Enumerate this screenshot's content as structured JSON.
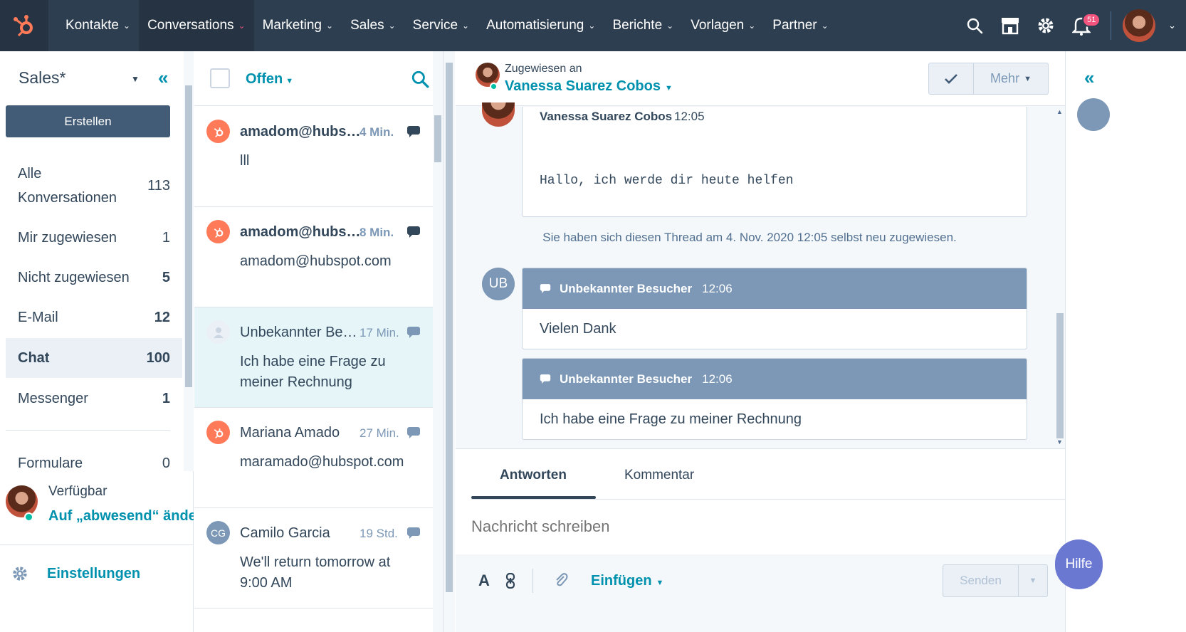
{
  "topnav": {
    "items": [
      {
        "label": "Kontakte"
      },
      {
        "label": "Conversations",
        "active": true
      },
      {
        "label": "Marketing"
      },
      {
        "label": "Sales"
      },
      {
        "label": "Service"
      },
      {
        "label": "Automatisierung"
      },
      {
        "label": "Berichte"
      },
      {
        "label": "Vorlagen"
      },
      {
        "label": "Partner"
      }
    ],
    "notifications_count": "51"
  },
  "sidebar": {
    "title": "Sales*",
    "create_label": "Erstellen",
    "items": [
      {
        "label": "Alle Konversationen",
        "count": "113"
      },
      {
        "label": "Mir zugewiesen",
        "count": "1"
      },
      {
        "label": "Nicht zugewiesen",
        "count": "5"
      },
      {
        "label": "E-Mail",
        "count": "12"
      },
      {
        "label": "Chat",
        "count": "100"
      },
      {
        "label": "Messenger",
        "count": "1"
      },
      {
        "label": "Formulare",
        "count": "0"
      }
    ],
    "status": "Verfügbar",
    "away_link": "Auf „abwesend“ ändern",
    "settings_label": "Einstellungen"
  },
  "convlist": {
    "filter_label": "Offen",
    "conversations": [
      {
        "name": "amadom@hubspot.com",
        "time": "4 Min.",
        "preview": "lll",
        "avatar": "hubspot"
      },
      {
        "name": "amadom@hubspot.com",
        "time": "8 Min.",
        "preview": "amadom@hubspot.com",
        "avatar": "hubspot"
      },
      {
        "name": "Unbekannter Besucher",
        "time": "17 Min.",
        "preview": "Ich habe eine Frage zu meiner Rechnung",
        "avatar": "unknown"
      },
      {
        "name": "Mariana Amado",
        "time": "27 Min.",
        "preview": "maramado@hubspot.com",
        "avatar": "hubspot"
      },
      {
        "name": "Camilo Garcia",
        "time": "19 Std.",
        "preview": "We'll return tomorrow at 9:00 AM",
        "avatar": "CG",
        "initials": "CG"
      }
    ]
  },
  "thread": {
    "assigned_label": "Zugewiesen an",
    "assignee": "Vanessa Suarez Cobos",
    "more_label": "Mehr",
    "agent_message": {
      "name": "Vanessa Suarez Cobos",
      "time": "12:05",
      "text": "Hallo, ich werde dir heute helfen"
    },
    "system_note": "Sie haben sich diesen Thread am 4. Nov. 2020 12:05 selbst neu zugewiesen.",
    "visitor_initials": "UB",
    "visitor_messages": [
      {
        "name": "Unbekannter Besucher",
        "time": "12:06",
        "text": "Vielen Dank"
      },
      {
        "name": "Unbekannter Besucher",
        "time": "12:06",
        "text": "Ich habe eine Frage zu meiner Rechnung"
      }
    ]
  },
  "composer": {
    "tabs": [
      {
        "label": "Antworten"
      },
      {
        "label": "Kommentar"
      }
    ],
    "placeholder": "Nachricht schreiben",
    "insert_label": "Einfügen",
    "send_label": "Senden",
    "format_label": "A"
  },
  "help_label": "Hilfe",
  "colors": {
    "nav_bg": "#2d3e50",
    "accent": "#0091ae",
    "hubspot_orange": "#ff7a59",
    "badge": "#f2547d",
    "visitor_header": "#7c98b6"
  }
}
